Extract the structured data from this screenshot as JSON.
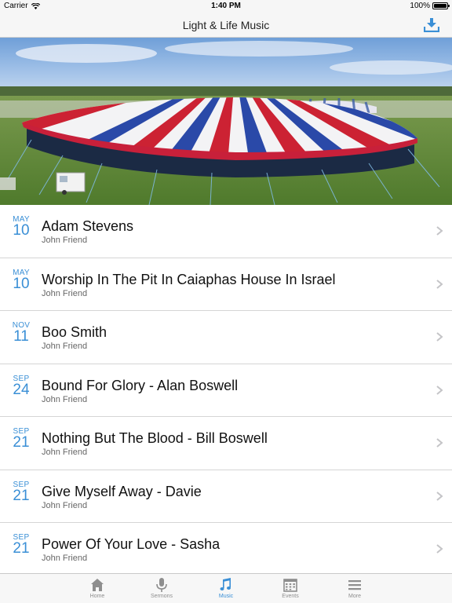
{
  "status_bar": {
    "carrier": "Carrier",
    "time": "1:40 PM",
    "battery": "100%"
  },
  "nav": {
    "title": "Light & Life Music",
    "download_icon": "download-icon"
  },
  "hero": {
    "image": "tent-photo"
  },
  "items": [
    {
      "month": "MAY",
      "day": "10",
      "title": "Adam Stevens",
      "subtitle": "John Friend"
    },
    {
      "month": "MAY",
      "day": "10",
      "title": "Worship In The Pit In Caiaphas House In Israel",
      "subtitle": "John Friend"
    },
    {
      "month": "NOV",
      "day": "11",
      "title": "Boo Smith",
      "subtitle": "John Friend"
    },
    {
      "month": "SEP",
      "day": "24",
      "title": "Bound For Glory - Alan Boswell",
      "subtitle": "John Friend"
    },
    {
      "month": "SEP",
      "day": "21",
      "title": "Nothing But The Blood - Bill Boswell",
      "subtitle": "John Friend"
    },
    {
      "month": "SEP",
      "day": "21",
      "title": "Give Myself Away - Davie",
      "subtitle": "John Friend"
    },
    {
      "month": "SEP",
      "day": "21",
      "title": "Power Of Your Love - Sasha",
      "subtitle": "John Friend"
    }
  ],
  "tabs": [
    {
      "label": "Home",
      "icon": "home-icon"
    },
    {
      "label": "Sermons",
      "icon": "microphone-icon"
    },
    {
      "label": "Music",
      "icon": "music-note-icon",
      "active": true
    },
    {
      "label": "Events",
      "icon": "calendar-icon"
    },
    {
      "label": "More",
      "icon": "menu-icon"
    }
  ],
  "colors": {
    "accent": "#3a8fd6",
    "bar_background": "#f6f6f6"
  }
}
